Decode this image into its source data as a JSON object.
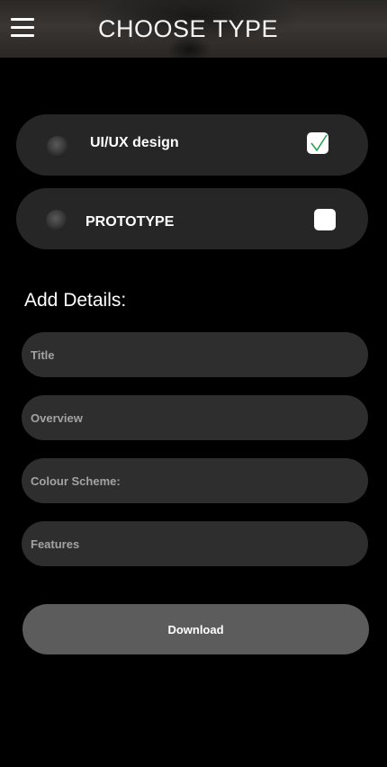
{
  "header": {
    "title": "CHOOSE TYPE",
    "menu_icon": "hamburger-menu-icon"
  },
  "types": [
    {
      "label": "UI/UX design",
      "checked": true,
      "thumb_icon": "thumbnail-image"
    },
    {
      "label": "PROTOTYPE",
      "checked": false,
      "thumb_icon": "thumbnail-image"
    }
  ],
  "details": {
    "heading": "Add Details:",
    "fields": [
      {
        "placeholder": "Title"
      },
      {
        "placeholder": "Overview"
      },
      {
        "placeholder": "Colour Scheme:"
      },
      {
        "placeholder": "Features"
      }
    ]
  },
  "actions": {
    "download_label": "Download"
  },
  "colors": {
    "background": "#000000",
    "card": "#262626",
    "field": "#2e2e2e",
    "button": "#5c5c5c",
    "check": "#2e9e4f"
  }
}
